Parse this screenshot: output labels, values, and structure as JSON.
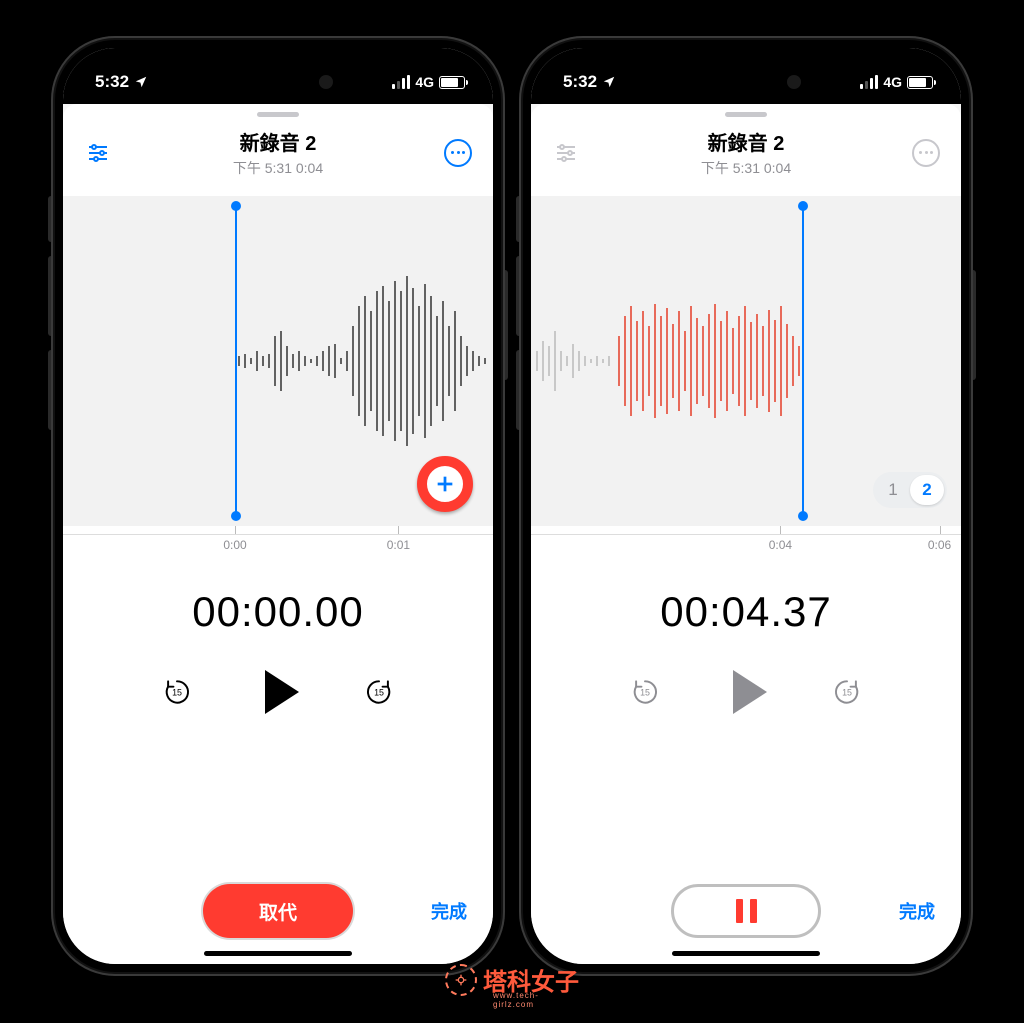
{
  "status": {
    "time": "5:32",
    "net": "4G"
  },
  "left": {
    "title": "新錄音 2",
    "subtitle": "下午 5:31  0:04",
    "playhead_pct": 40,
    "ticks": [
      {
        "pct": 40,
        "label": "0:00"
      },
      {
        "pct": 78,
        "label": "0:01"
      }
    ],
    "time": "00:00.00",
    "skip_seconds": "15",
    "replace_label": "取代",
    "done_label": "完成"
  },
  "right": {
    "title": "新錄音 2",
    "subtitle": "下午 5:31  0:04",
    "playhead_pct": 63,
    "ticks": [
      {
        "pct": 58,
        "label": "0:04"
      },
      {
        "pct": 95,
        "label": "0:06"
      }
    ],
    "time": "00:04.37",
    "skip_seconds": "15",
    "layers": [
      "1",
      "2"
    ],
    "active_layer": 1,
    "done_label": "完成"
  },
  "watermark": {
    "text": "塔科女子",
    "sub": "www.tech-girlz.com"
  }
}
